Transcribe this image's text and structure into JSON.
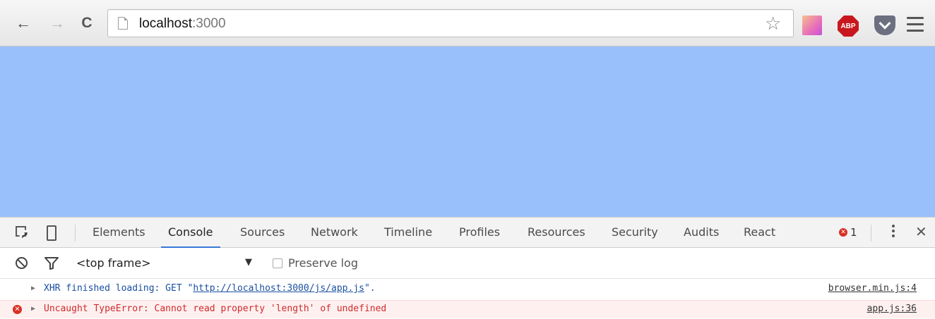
{
  "browser": {
    "url_host": "localhost",
    "url_port": ":3000",
    "extensions": {
      "abp_label": "ABP"
    }
  },
  "page": {
    "background": "#99c0fb"
  },
  "devtools": {
    "tabs": [
      {
        "label": "Elements",
        "active": false
      },
      {
        "label": "Console",
        "active": true
      },
      {
        "label": "Sources",
        "active": false
      },
      {
        "label": "Network",
        "active": false
      },
      {
        "label": "Timeline",
        "active": false
      },
      {
        "label": "Profiles",
        "active": false
      },
      {
        "label": "Resources",
        "active": false
      },
      {
        "label": "Security",
        "active": false
      },
      {
        "label": "Audits",
        "active": false
      },
      {
        "label": "React",
        "active": false
      }
    ],
    "error_count": "1",
    "console_toolbar": {
      "context": "<top frame>",
      "preserve_log_label": "Preserve log",
      "preserve_log_checked": false
    },
    "messages": [
      {
        "type": "info",
        "prefix": "XHR finished loading: GET \"",
        "url": "http://localhost:3000/js/app.js",
        "suffix": "\".",
        "source": "browser.min.js:4"
      },
      {
        "type": "error",
        "text": "Uncaught TypeError: Cannot read property 'length' of undefined",
        "source": "app.js:36"
      }
    ]
  }
}
